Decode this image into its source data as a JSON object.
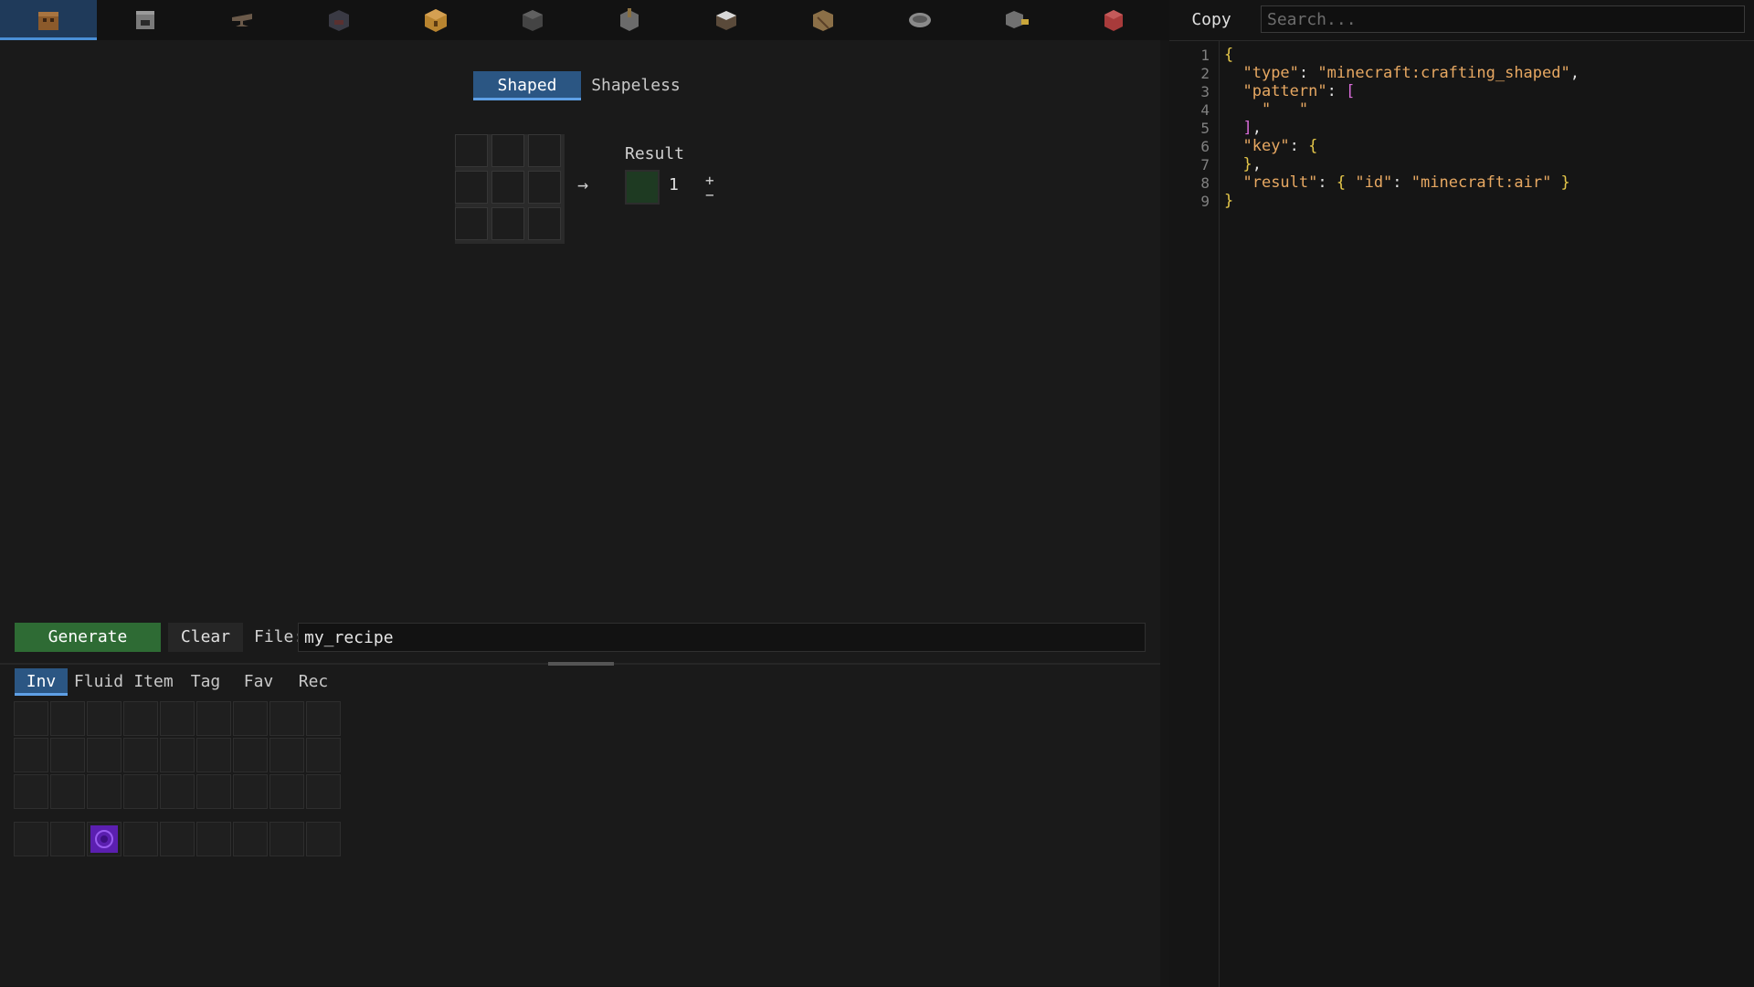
{
  "station_tabs": [
    {
      "icon": "crafting-table-icon",
      "color": "#8b5a2b",
      "active": true
    },
    {
      "icon": "furnace-icon",
      "color": "#7a7a7a",
      "active": false
    },
    {
      "icon": "anvil-icon",
      "color": "#6b5a4a",
      "active": false
    },
    {
      "icon": "blast-furnace-icon",
      "color": "#5a3030",
      "active": false
    },
    {
      "icon": "barrel-icon",
      "color": "#b8842f",
      "active": false
    },
    {
      "icon": "smoker-icon",
      "color": "#444444",
      "active": false
    },
    {
      "icon": "brewing-stand-icon",
      "color": "#6b6b6b",
      "active": false
    },
    {
      "icon": "smithing-table-icon",
      "color": "#7b6a52",
      "active": false
    },
    {
      "icon": "fletching-table-icon",
      "color": "#8b6f47",
      "active": false
    },
    {
      "icon": "campfire-icon",
      "color": "#8a8a8a",
      "active": false
    },
    {
      "icon": "stonecutter-icon",
      "color": "#707070",
      "active": false
    },
    {
      "icon": "cartography-icon",
      "color": "#a83b3b",
      "active": false
    }
  ],
  "recipe_modes": [
    "Shaped",
    "Shapeless"
  ],
  "result": {
    "label": "Result",
    "count": "1",
    "plus": "+",
    "minus": "−",
    "slot_color": "#1e3a22"
  },
  "arrow": "→",
  "actions": {
    "generate": "Generate",
    "clear": "Clear"
  },
  "file": {
    "label": "File:",
    "value": "my_recipe"
  },
  "inventory_tabs": [
    "Inv",
    "Fluid",
    "Item",
    "Tag",
    "Fav",
    "Rec"
  ],
  "inventory_item": {
    "icon": "nether-portal-icon",
    "color": "#5b1fb0"
  },
  "json_panel": {
    "copy_label": "Copy",
    "search_placeholder": "Search..."
  },
  "code_lines": [
    {
      "num": "1"
    },
    {
      "num": "2"
    },
    {
      "num": "3"
    },
    {
      "num": "4"
    },
    {
      "num": "5"
    },
    {
      "num": "6"
    },
    {
      "num": "7"
    },
    {
      "num": "8"
    },
    {
      "num": "9"
    }
  ],
  "code": {
    "l1_brace": "{",
    "l2_key": "\"type\"",
    "l2_colon": ": ",
    "l2_val": "\"minecraft:crafting_shaped\"",
    "l2_comma": ",",
    "l3_key": "\"pattern\"",
    "l3_colon": ": ",
    "l3_open": "[",
    "l4_val": "\"   \"",
    "l5_close": "]",
    "l5_comma": ",",
    "l6_key": "\"key\"",
    "l6_colon": ": ",
    "l6_open": "{",
    "l7_close": "}",
    "l7_comma": ",",
    "l8_key": "\"result\"",
    "l8_colon": ": ",
    "l8_open": "{ ",
    "l8_idkey": "\"id\"",
    "l8_colon2": ": ",
    "l8_idval": "\"minecraft:air\"",
    "l8_close": " }",
    "l9_brace": "}"
  }
}
